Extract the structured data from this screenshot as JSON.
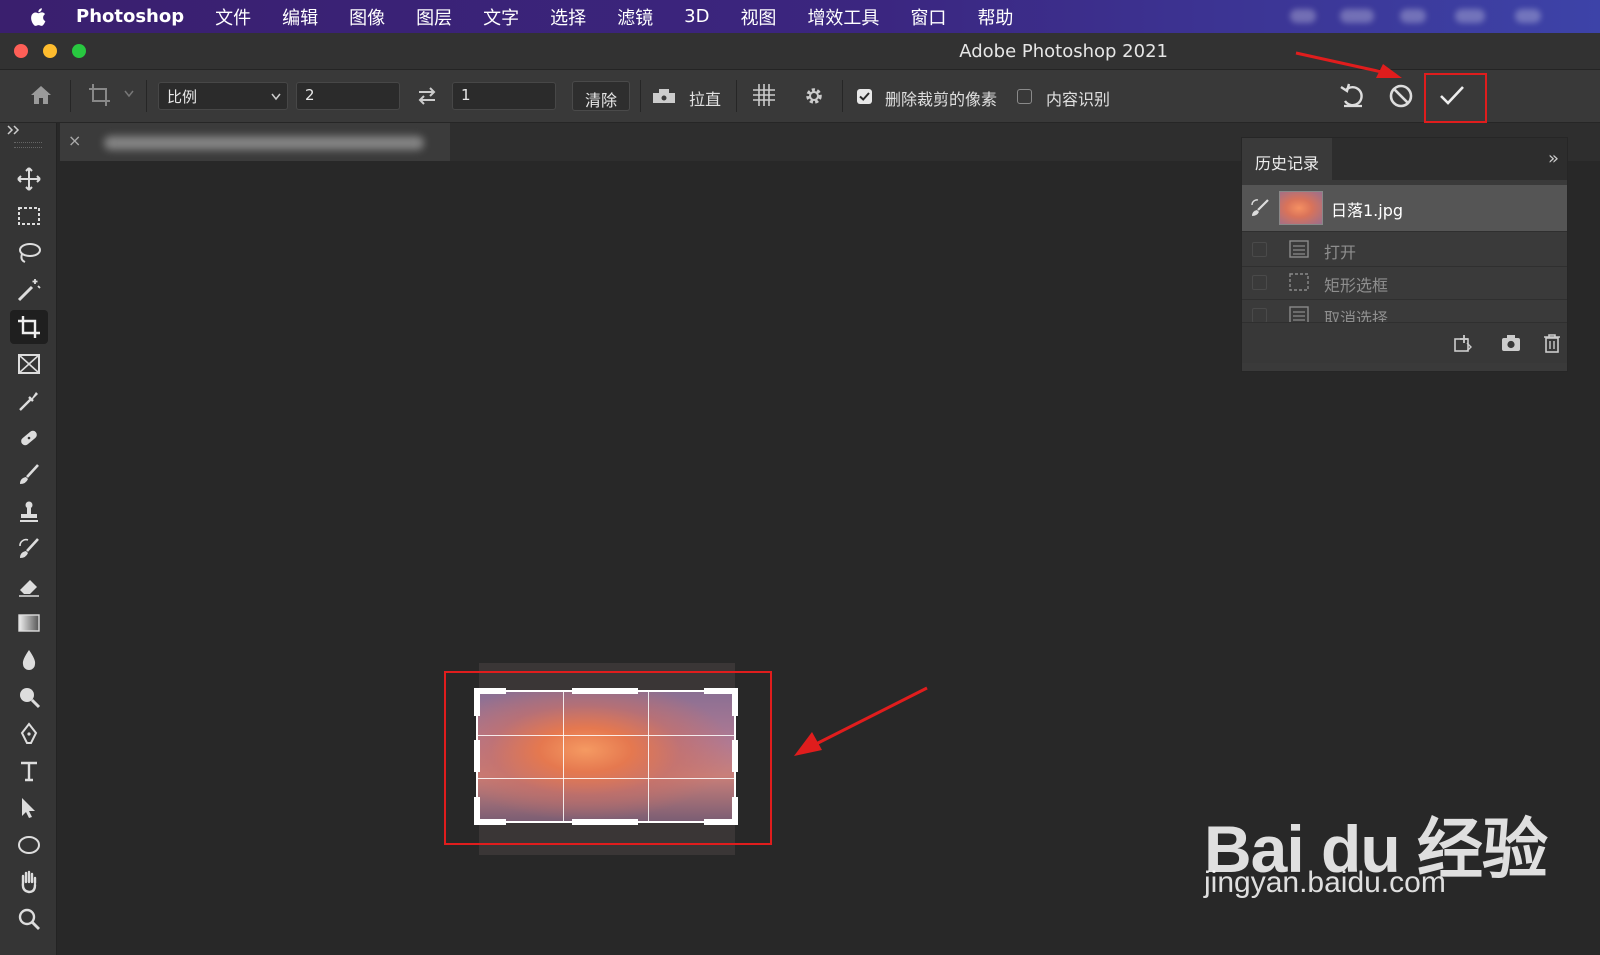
{
  "menubar": {
    "app": "Photoshop",
    "items": [
      "文件",
      "编辑",
      "图像",
      "图层",
      "文字",
      "选择",
      "滤镜",
      "3D",
      "视图",
      "增效工具",
      "窗口",
      "帮助"
    ]
  },
  "window": {
    "title": "Adobe Photoshop 2021"
  },
  "options": {
    "ratio_select": "比例",
    "width_value": "2",
    "height_value": "1",
    "clear_label": "清除",
    "straighten_label": "拉直",
    "delete_cropped_label": "删除裁剪的像素",
    "delete_cropped_checked": true,
    "content_aware_label": "内容识别",
    "content_aware_checked": false
  },
  "document": {
    "tab_close": "×"
  },
  "history": {
    "tab_label": "历史记录",
    "menu_glyph": "»",
    "snapshot_label": "日落1.jpg",
    "steps": [
      {
        "label": "打开",
        "icon": "document-icon"
      },
      {
        "label": "矩形选框",
        "icon": "marquee-icon"
      },
      {
        "label": "取消选择",
        "icon": "document-icon"
      }
    ]
  },
  "watermark": {
    "brand": "Bai du 经验",
    "url": "jingyan.baidu.com"
  },
  "colors": {
    "accent_red": "#e01d1d",
    "menubar": "#3b2680",
    "panel": "#3a3a3a"
  }
}
